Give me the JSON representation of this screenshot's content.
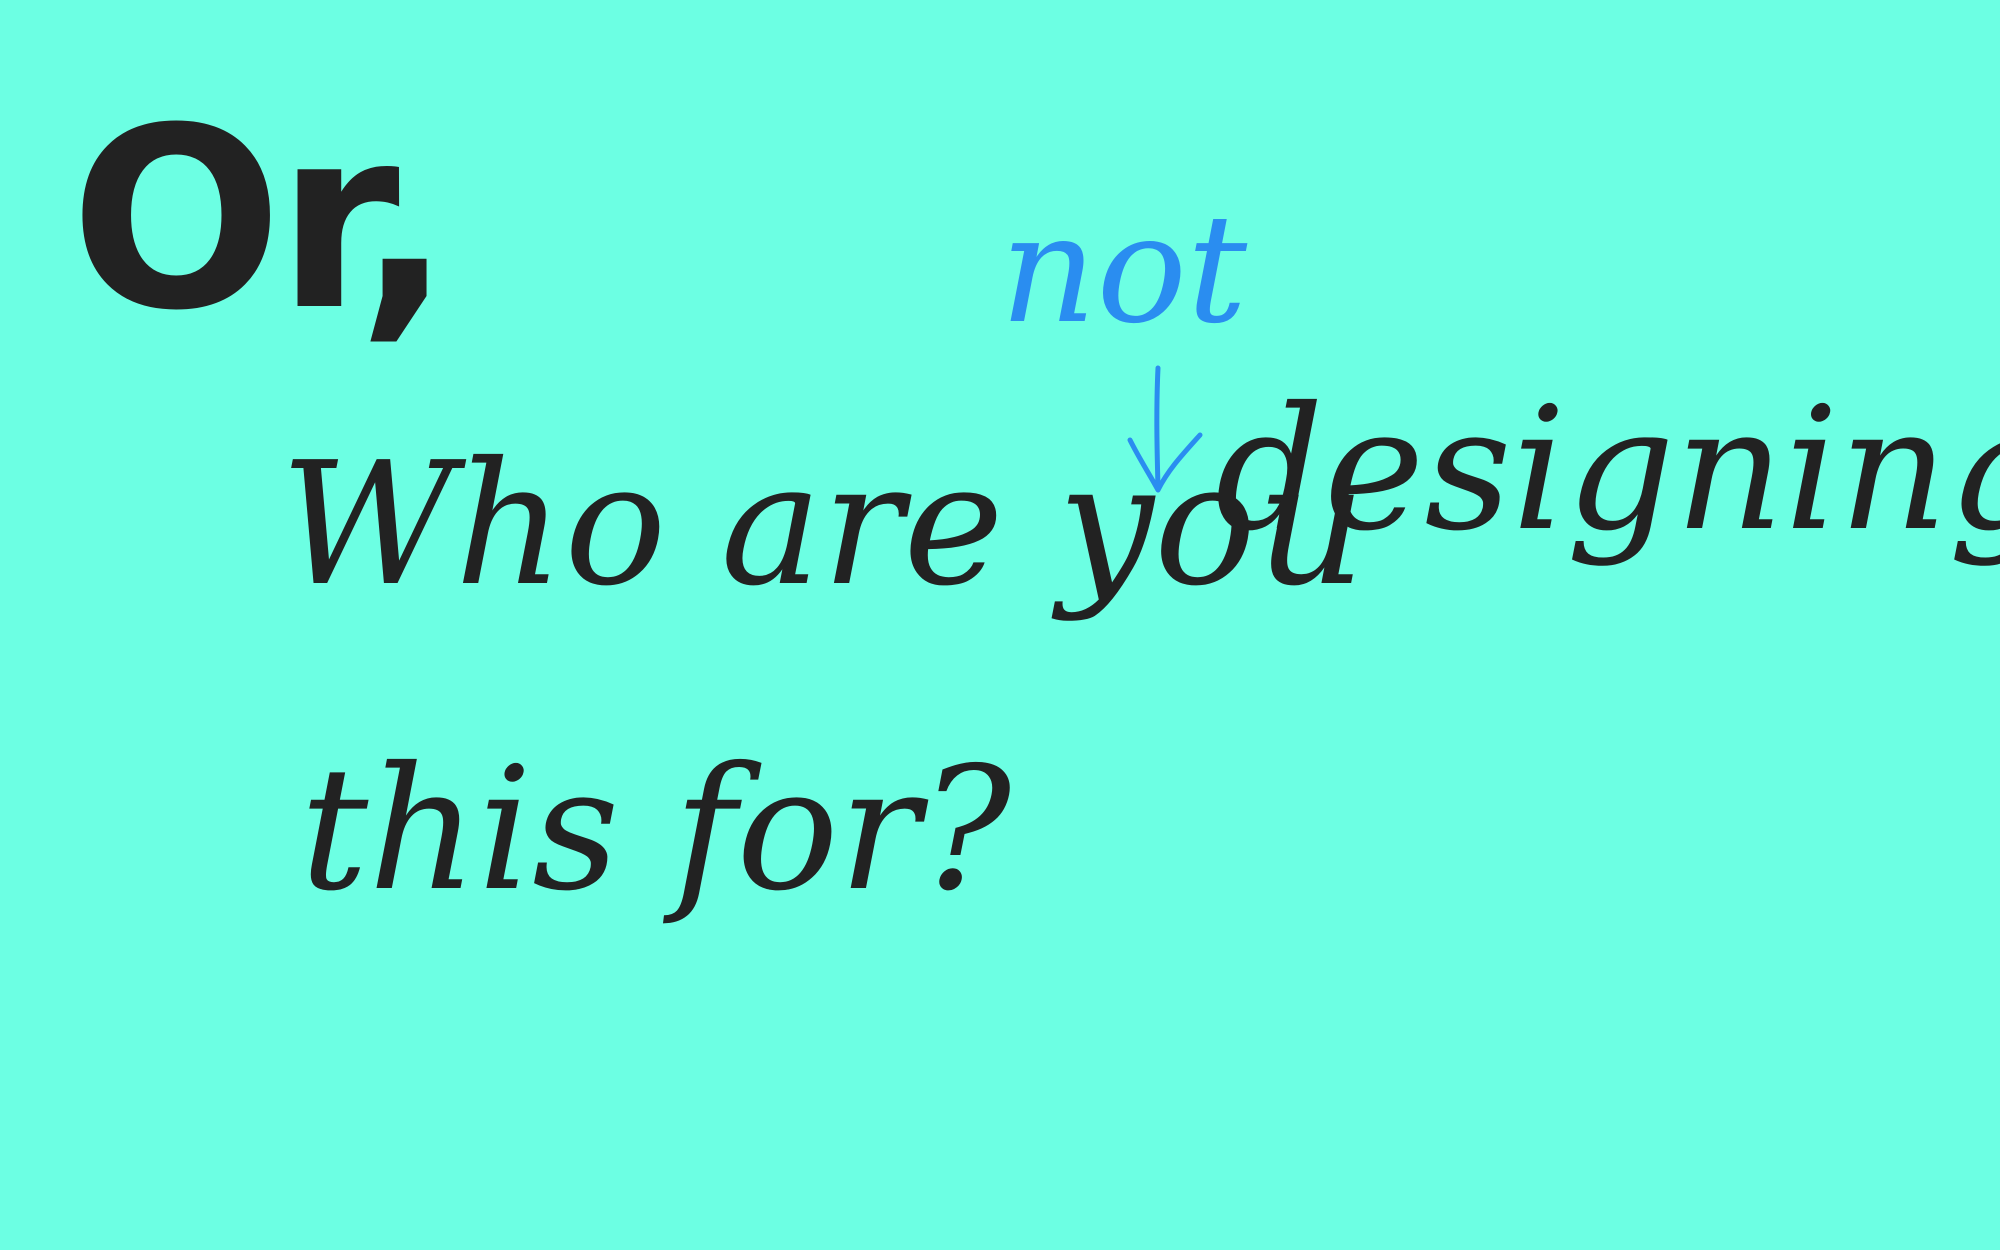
{
  "colors": {
    "background": "#6cffe3",
    "ink": "#222222",
    "annotation": "#2a8df0"
  },
  "note": {
    "heading": "Or,",
    "line1_start": "Who are you",
    "line1_end": "designing",
    "line2": "this for?",
    "insertion": "not"
  },
  "icons": {
    "insert_arrow": "arrow-down-icon"
  }
}
